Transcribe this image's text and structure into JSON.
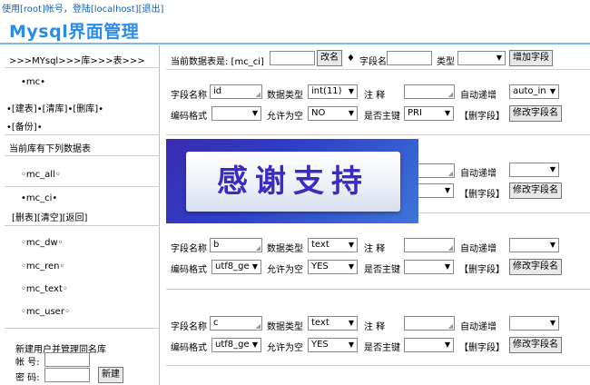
{
  "header": {
    "login": {
      "prefix": "使用[",
      "user": "root",
      "middle": "]帐号，登陆[",
      "host": "localhost",
      "suffix": "]",
      "logout": "[退出]"
    },
    "title": "Mysql界面管理"
  },
  "sidebar": {
    "breadcrumb": ">>>MYsql>>>库>>>表>>>",
    "current_db": "•mc•",
    "db_actions": {
      "b0": "•",
      "create_table": "[建表]",
      "b1": "•",
      "clear_db": "[清库]",
      "b2": "•",
      "delete_db": "[删库]",
      "b3": "•",
      "b4": "•",
      "backup": "[备份]",
      "b5": "•"
    },
    "tables_heading": "当前库有下列数据表",
    "tables": [
      {
        "label": "◦mc_all◦"
      },
      {
        "label": "•mc_ci•"
      },
      {
        "label": "◦mc_dw◦"
      },
      {
        "label": "◦mc_ren◦"
      },
      {
        "label": "◦mc_text◦"
      },
      {
        "label": "◦mc_user◦"
      }
    ],
    "table_actions": {
      "delete": "[删表]",
      "clear": "[清空]",
      "back": "[返回]"
    },
    "new_user": {
      "heading": "新建用户并管理同名库",
      "account_label": "帐 号:",
      "account_value": "",
      "password_label": "密 码:",
      "password_value": "",
      "submit": "新建"
    }
  },
  "toolbar": {
    "current_table_label": "当前数据表是: [mc_ci]",
    "rename_input": "",
    "rename_button": "改名",
    "separator": "♦",
    "field_name_label": "字段名",
    "field_name_input": "",
    "type_label": "类型",
    "type_select": "",
    "add_field_button": "增加字段"
  },
  "labels": {
    "field_name": "字段名称",
    "data_type": "数据类型",
    "note": "注    释",
    "auto_inc": "自动递增",
    "encoding": "编码格式",
    "nullable": "允许为空",
    "primary": "是否主键",
    "delete_field": "【删字段】",
    "modify_field": "修改字段名"
  },
  "fields": [
    {
      "name": "id",
      "type": "int(11)",
      "note": "",
      "auto_inc": "auto_in",
      "encoding": "",
      "nullable": "NO",
      "primary": "PRI"
    },
    {
      "name": "",
      "type": "",
      "note": "",
      "auto_inc": "",
      "encoding": "",
      "nullable": "",
      "primary": ""
    },
    {
      "name": "b",
      "type": "text",
      "note": "",
      "auto_inc": "",
      "encoding": "utf8_ge",
      "nullable": "YES",
      "primary": ""
    },
    {
      "name": "c",
      "type": "text",
      "note": "",
      "auto_inc": "",
      "encoding": "utf8_ge",
      "nullable": "YES",
      "primary": ""
    }
  ],
  "banner": {
    "text": "感谢支持"
  },
  "icons": {
    "dropdown": "▼",
    "resize": "◢"
  },
  "colors": {
    "title": "#2b8ce8",
    "login": "#1a5fb4",
    "banner_bg": "#2e3fc7",
    "banner_text": "#3a2cc0"
  }
}
